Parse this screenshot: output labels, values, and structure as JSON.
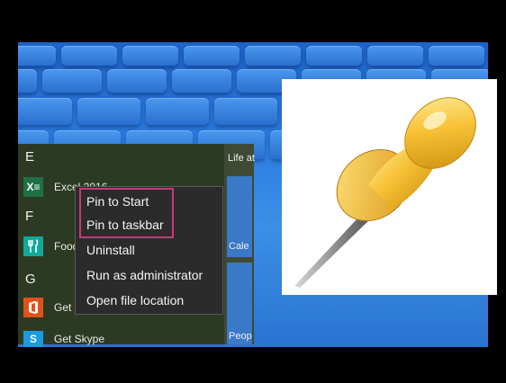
{
  "start_menu": {
    "groups": [
      {
        "letter": "E",
        "apps": [
          {
            "name": "Excel 2016",
            "icon": "excel-icon",
            "color": "#1e7145"
          }
        ]
      },
      {
        "letter": "F",
        "apps": [
          {
            "name": "Food",
            "icon": "fork-knife-icon",
            "color": "#12a89a"
          }
        ]
      },
      {
        "letter": "G",
        "apps": [
          {
            "name": "Get",
            "icon": "office-icon",
            "color": "#e4501c"
          },
          {
            "name": "Get Skype",
            "icon": "skype-icon",
            "color": "#1a9bdd"
          }
        ]
      }
    ],
    "tiles": {
      "life_at": "Life at",
      "calendar": "Cale",
      "people": "Peop"
    }
  },
  "context_menu": {
    "items": [
      "Pin to Start",
      "Pin to taskbar",
      "Uninstall",
      "Run as administrator",
      "Open file location"
    ],
    "highlight_color": "#c43a7a"
  },
  "illustration": {
    "icon": "pushpin-icon"
  }
}
